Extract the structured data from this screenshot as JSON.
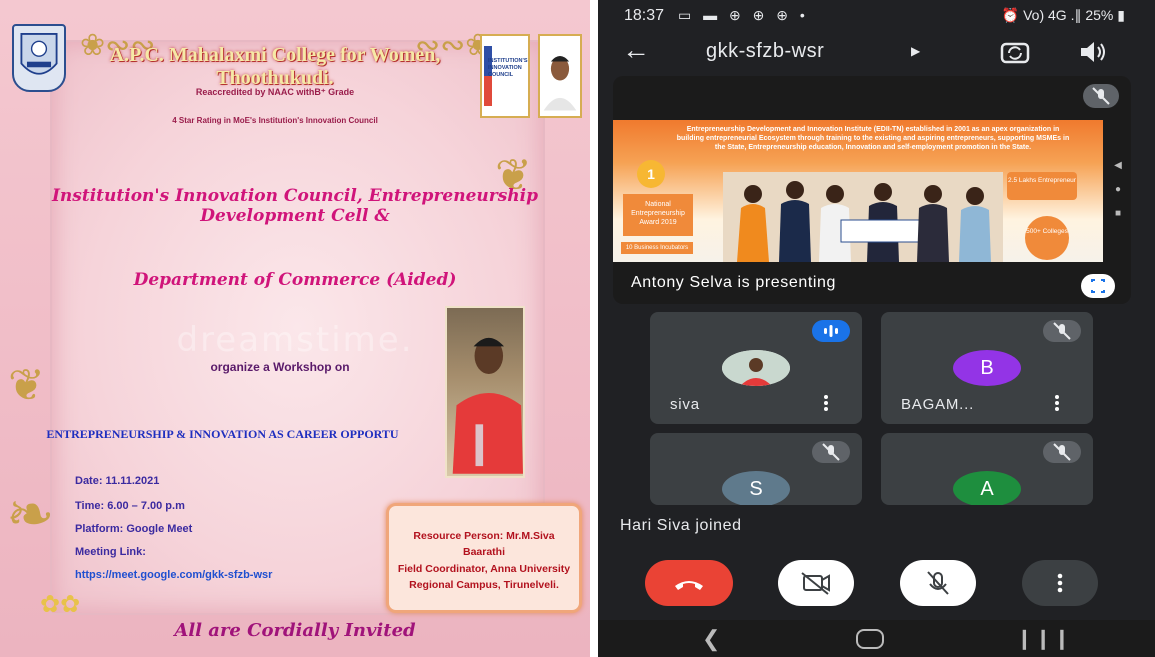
{
  "poster": {
    "college_name": "A.P.C. Mahalaxmi College for Women, Thoothukudi.",
    "accreditation": "Reaccredited by NAAC withB⁺ Grade",
    "rating": "4 Star Rating in MoE's Institution's Innovation Council",
    "iic_logo_text": "INSTITUTION'S INNOVATION COUNCIL",
    "organizers_line1": "Institution's Innovation Council, Entrepreneurship Development Cell &",
    "organizers_line2": "Department of Commerce (Aided)",
    "watermark": "dreamstime.",
    "organize_text": "organize a Workshop on",
    "topic": "ENTREPRENEURSHIP & INNOVATION AS CAREER OPPORTU",
    "date": "Date: 11.11.2021",
    "time": "Time: 6.00 – 7.00 p.m",
    "platform": "Platform: Google Meet",
    "meeting_link_label": "Meeting Link:",
    "meeting_link": "https://meet.google.com/gkk-sfzb-wsr",
    "resource_person": "Resource Person: Mr.M.Siva Baarathi",
    "resource_role": "Field Coordinator, Anna University Regional Campus, Tirunelveli.",
    "closing": "All are Cordially Invited"
  },
  "phone": {
    "status": {
      "time": "18:37",
      "left_icons": "▭ ▬ ⊕ ⊕ ⊕ •",
      "battery": "25%",
      "right_icons": "⏰ Vo) 4G .∥"
    },
    "meet_code": "gkk-sfzb-wsr",
    "presentation": {
      "label": "Antony Selva is presenting",
      "slide_text": "Entrepreneurship Development and Innovation Institute (EDII-TN) established in 2001 as an apex organization in building entrepreneurial Ecosystem through training to the existing and aspiring entrepreneurs, supporting MSMEs in the State, Entrepreneurship education, Innovation and self-employment promotion in the State.",
      "slide_award": "National Entrepreneurship Award 2019",
      "slide_badge_1": "1",
      "slide_stat_1": "2.5 Lakhs Entrepreneur",
      "slide_stat_2": "500+ Colleges",
      "slide_footer": "10 Business Incubators"
    },
    "participants": [
      {
        "name": "siva",
        "avatar_letter": "",
        "avatar_color": "#ffffff",
        "status": "speaking"
      },
      {
        "name": "BAGAM...",
        "avatar_letter": "B",
        "avatar_color": "#9334e6",
        "status": "muted"
      },
      {
        "name": "",
        "avatar_letter": "S",
        "avatar_color": "#5f7a8c",
        "status": "muted"
      },
      {
        "name": "",
        "avatar_letter": "A",
        "avatar_color": "#1e8e3e",
        "status": "muted"
      }
    ],
    "toast": "Hari Siva joined"
  },
  "colors": {
    "meet_bg": "#202124",
    "tile_bg": "#3c4043",
    "end_call": "#ea4335",
    "speaking_badge": "#1a73e8",
    "poster_pink": "#f4c8d0",
    "script_magenta": "#d0147a"
  }
}
